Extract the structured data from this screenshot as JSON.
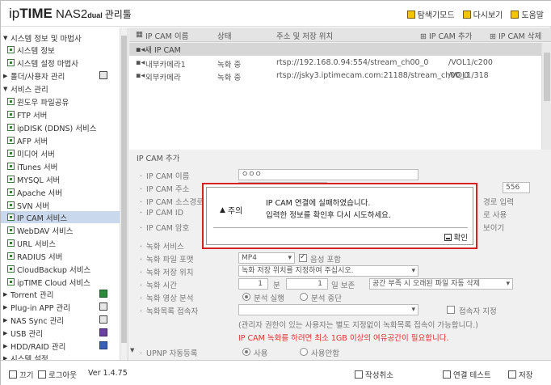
{
  "header": {
    "logo_ip": "ip",
    "logo_time": "TIME",
    "logo_model": " NAS2",
    "logo_dual": "dual",
    "logo_suffix": "관리툴",
    "links": {
      "explorer": "탐색기모드",
      "refresh": "다시보기",
      "help": "도움말"
    }
  },
  "sidebar": {
    "sys_info": "시스템 정보 및 마법사",
    "sys_info_item": "시스템 정보",
    "sys_wizard": "시스템 설정 마법사",
    "folder_user": "폴더/사용자 관리",
    "service_mgmt": "서비스 관리",
    "svc": [
      "윈도우 파일공유",
      "FTP 서버",
      "ipDISK (DDNS) 서비스",
      "AFP 서버",
      "미디어 서버",
      "iTunes 서버",
      "MYSQL 서버",
      "Apache 서버",
      "SVN 서버",
      "IP CAM 서비스",
      "WebDAV 서비스",
      "URL 서비스",
      "RADIUS 서버",
      "CloudBackup 서비스",
      "ipTIME Cloud 서비스"
    ],
    "torrent": "Torrent 관리",
    "plugin": "Plug-in APP 관리",
    "nas_sync": "NAS Sync 관리",
    "usb": "USB 관리",
    "hdd_raid": "HDD/RAID 관리",
    "extra": "시스템 설정"
  },
  "footer": {
    "exit": "끄기",
    "logout": "로그아웃",
    "version": "Ver 1.4.75",
    "cancel": "작성취소",
    "test": "연결 테스트",
    "save": "저장"
  },
  "list": {
    "headers": {
      "name": "IP CAM 이름",
      "status": "상태",
      "addr": "주소 및 저장 위치",
      "add": "IP CAM 추가",
      "del": "IP CAM 삭제"
    },
    "new_row": "새 IP CAM",
    "rows": [
      {
        "name": "내부카메라1",
        "status": "녹화 중",
        "url": "rtsp://192.168.0.94:554/stream_ch00_0",
        "path": "/VOL1/c200"
      },
      {
        "name": "외부카메라",
        "status": "녹화 중",
        "url": "rtsp://jsky3.iptimecam.com:21188/stream_ch00_0",
        "path": "/VOL1/318"
      }
    ]
  },
  "form": {
    "title": "IP CAM 추가",
    "labels": {
      "name": "IP CAM 이름",
      "addr": "IP CAM 주소",
      "src": "IP CAM 소스경로",
      "id": "IP CAM ID",
      "pw": "IP CAM 암호",
      "rec_svc": "녹화 서비스",
      "fmt": "녹화 파일 포맷",
      "loc": "녹화 저장 위치",
      "time": "녹화 시간",
      "analysis": "녹화 영상 분석",
      "list_user": "녹화목록 접속자",
      "upnp": "UPNP 자동등록"
    },
    "name_value": "ㅇㅇㅇ",
    "port_value": "556",
    "right_direct": "경로 입력",
    "right_auto": "로 사용",
    "right_show": "보이기",
    "fmt_value": "MP4",
    "audio_label": "음성 포함",
    "loc_placeholder": "녹화 저장 위치를 지정하여 주십시오.",
    "minutes_value": "1",
    "minutes_unit": "분",
    "days_value": "1",
    "days_unit": "일 보존",
    "policy_value": "공간 부족 시 오래된 파일 자동 삭제",
    "analysis_on": "분석 실행",
    "analysis_off": "분석 중단",
    "user_label": "접속자 지정",
    "note": "(관리자 권한이 있는 사용자는 별도 지정없이 녹화목록 접속이 가능합니다.)",
    "warning": "IP CAM 녹화를 하려면 최소 1GB 이상의 여유공간이 필요합니다.",
    "upnp_use": "사용",
    "upnp_nouse": "사용안함"
  },
  "dialog": {
    "title": "주의",
    "msg1": "IP CAM 연결에 실패하였습니다.",
    "msg2": "입력한 정보를 확인후 다시 시도하세요.",
    "ok": "확인"
  }
}
